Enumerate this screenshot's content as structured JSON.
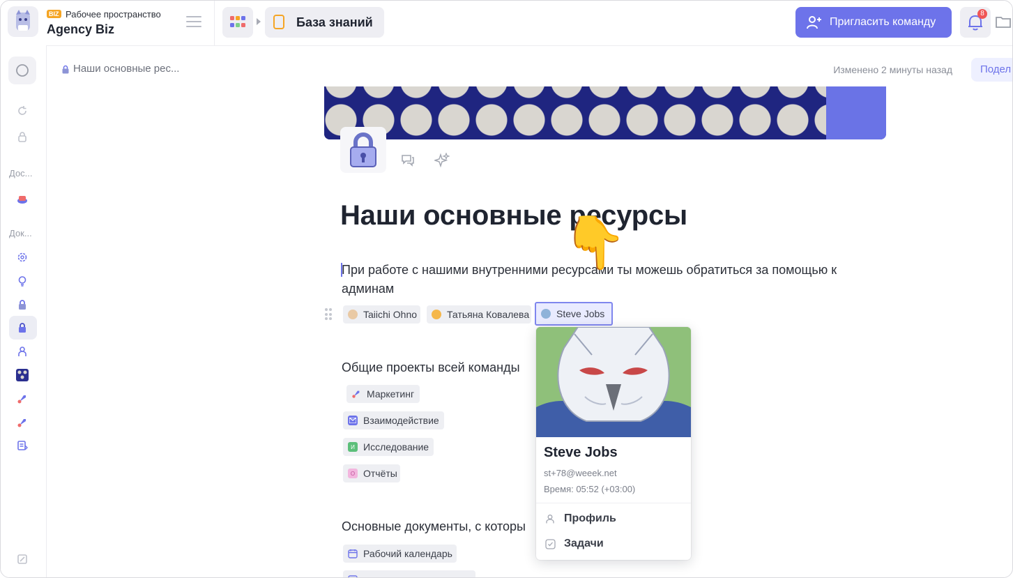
{
  "workspace": {
    "badge": "BIZ",
    "subtitle": "Рабочее пространство",
    "name": "Agency Biz"
  },
  "topbar": {
    "breadcrumb_page": "База знаний",
    "invite_label": "Пригласить команду",
    "notifications_count": "8"
  },
  "sidebar": {
    "section_1": "Дос...",
    "section_2": "Док..."
  },
  "doc": {
    "breadcrumb": "Наши основные рес...",
    "changed": "Изменено 2 минуты назад",
    "share_label": "Подел",
    "title": "Наши основные ресурсы",
    "paragraph": "При работе с нашими внутренними ресурсами ты можешь обратиться за помощью к админам",
    "mentions": [
      "Taiichi Ohno",
      "Татьяна Ковалева",
      "Steve Jobs"
    ],
    "section_projects": "Общие проекты всей команды",
    "projects": [
      {
        "label": "Маркетинг",
        "avatar": ""
      },
      {
        "label": "Взаимодействие",
        "avatar": ""
      },
      {
        "label": "Исследование",
        "avatar": "И"
      },
      {
        "label": "Отчёты",
        "avatar": "О"
      }
    ],
    "section_docs": "Основные документы, с которы",
    "docs": [
      "Рабочий календарь",
      ""
    ]
  },
  "popover": {
    "name": "Steve Jobs",
    "email": "st+78@weeek.net",
    "time": "Время: 05:52 (+03:00)",
    "profile_label": "Профиль",
    "tasks_label": "Задачи"
  },
  "colors": {
    "accent": "#6d73ea",
    "badge_orange": "#f5a524",
    "notify_red": "#f05656"
  }
}
